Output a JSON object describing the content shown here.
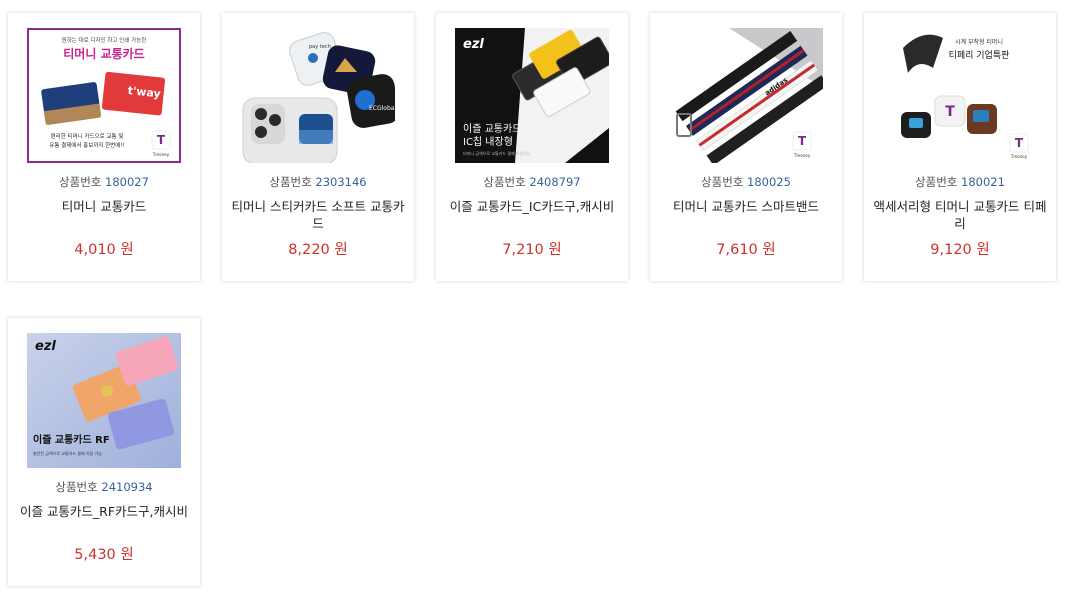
{
  "colors": {
    "price": "#d0312d",
    "product_number": "#3a5f9a",
    "label": "#555555"
  },
  "products": [
    {
      "id_label": "상품번호",
      "id": "180027",
      "name": "티머니 교통카드",
      "price": "4,010 원",
      "image": {
        "line1": "원하는 대로 디자인 하고 인쇄 가능한",
        "title": "티머니 교통카드",
        "line2": "편리한 티머니 카드으로 교통 및",
        "line3": "유통 결제에서 홍보까지 한번에!!",
        "logo": "Tmoney"
      }
    },
    {
      "id_label": "상품번호",
      "id": "2303146",
      "name": "티머니 스티커카드 소프트 교통카드",
      "price": "8,220 원",
      "image": {
        "logo": "pay tech"
      }
    },
    {
      "id_label": "상품번호",
      "id": "2408797",
      "name": "이즐 교통카드_IC카드구,캐시비",
      "price": "7,210 원",
      "image": {
        "brand": "ezl",
        "title1": "이즐 교통카드",
        "title2": "IC칩 내장형",
        "line": "티머니 금액으로 교통카드 결제 이용가능"
      }
    },
    {
      "id_label": "상품번호",
      "id": "180025",
      "name": "티머니 교통카드 스마트밴드",
      "price": "7,610 원",
      "image": {
        "logo": "Tmoney",
        "brand": "adidas"
      }
    },
    {
      "id_label": "상품번호",
      "id": "180021",
      "name": "액세서리형 티머니 교통카드 티페리",
      "price": "9,120 원",
      "image": {
        "line1": "시계 부착형 티머니",
        "title": "티페리 기업특판",
        "logo": "Tmoney"
      }
    },
    {
      "id_label": "상품번호",
      "id": "2410934",
      "name": "이즐 교통카드_RF카드구,캐시비",
      "price": "5,430 원",
      "image": {
        "brand": "ezl",
        "title": "이즐 교통카드 RF",
        "line": "충전된 금액으로 교통카드 결제 이용 가능"
      }
    }
  ]
}
